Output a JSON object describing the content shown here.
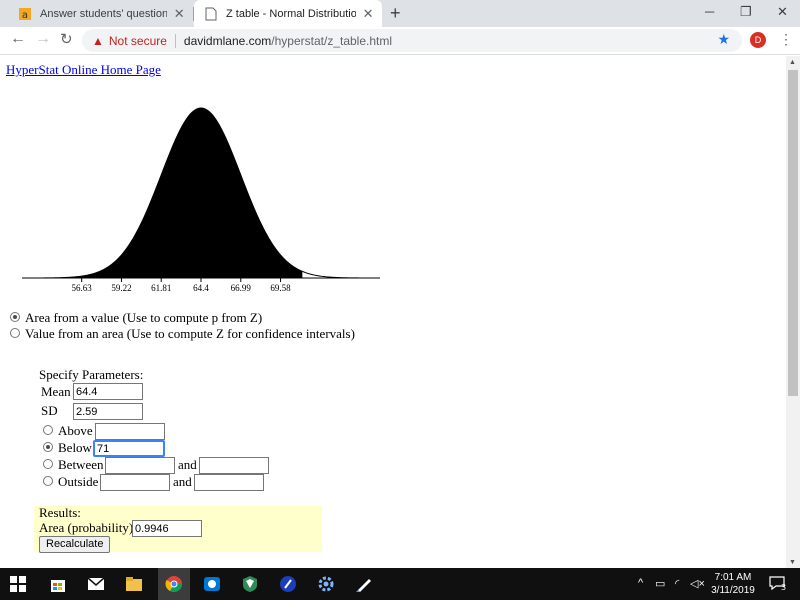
{
  "browser": {
    "tabs": [
      {
        "title": "Answer students' questions and"
      },
      {
        "title": "Z table - Normal Distribution Ca"
      }
    ],
    "new_tab": "+",
    "controls": {
      "minimize": "─",
      "restore": "❐",
      "close": "✕"
    },
    "security_label": "Not secure",
    "url_host": "davidmlane.com",
    "url_path": "/hyperstat/z_table.html",
    "avatar_letter": "D"
  },
  "page": {
    "home_link": "HyperStat Online Home Page",
    "chart_data": {
      "type": "area",
      "mean": 64.4,
      "sd": 2.59,
      "shaded_below": 71,
      "x_ticks": [
        "56.63",
        "59.22",
        "61.81",
        "64.4",
        "66.99",
        "69.58"
      ]
    },
    "mode_options": [
      {
        "label": "Area from a value (Use to compute p from Z)",
        "selected": true
      },
      {
        "label": "Value from an area (Use to compute Z for confidence intervals)",
        "selected": false
      }
    ],
    "params": {
      "heading": "Specify Parameters:",
      "mean_label": "Mean",
      "mean_value": "64.4",
      "sd_label": "SD",
      "sd_value": "2.59",
      "above_label": "Above",
      "above_value": "",
      "below_label": "Below",
      "below_value": "71",
      "between_label": "Between",
      "outside_label": "Outside",
      "and_label": "and"
    },
    "results": {
      "heading": "Results:",
      "area_label": "Area (probability)",
      "area_value": "0.9946",
      "recalculate": "Recalculate"
    }
  },
  "taskbar": {
    "time": "7:01 AM",
    "date": "3/11/2019",
    "notifications": "3"
  }
}
